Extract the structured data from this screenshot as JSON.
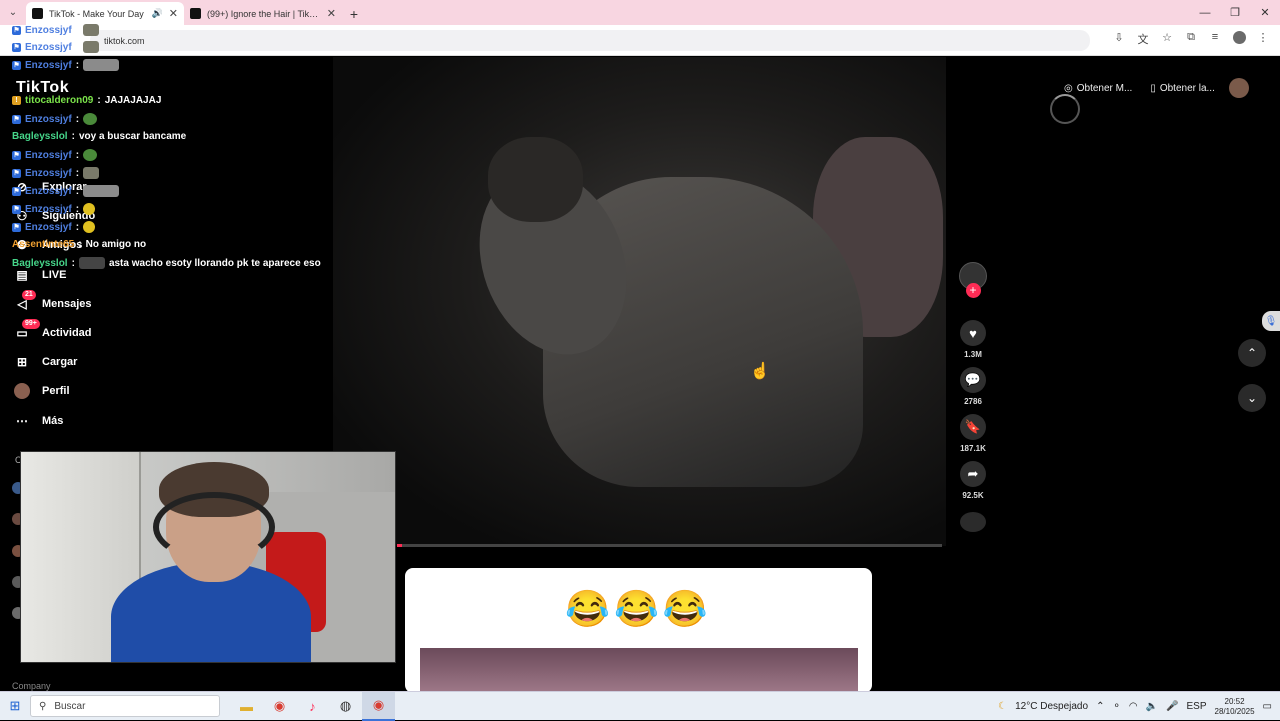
{
  "browser": {
    "tabs": [
      {
        "title": "TikTok - Make Your Day",
        "active": true,
        "audio": true
      },
      {
        "title": "(99+) Ignore the Hair | TikTok",
        "active": false
      }
    ],
    "url": "tiktok.com"
  },
  "sidebar": {
    "logo": "TikTok",
    "items": [
      {
        "label": "Explorar",
        "icon": "compass-icon"
      },
      {
        "label": "Siguiendo",
        "icon": "following-icon"
      },
      {
        "label": "Amigos",
        "icon": "friends-icon"
      },
      {
        "label": "LIVE",
        "icon": "live-icon"
      },
      {
        "label": "Mensajes",
        "icon": "messages-icon",
        "badge": "21"
      },
      {
        "label": "Actividad",
        "icon": "activity-icon",
        "badge": "99+"
      },
      {
        "label": "Cargar",
        "icon": "upload-icon"
      },
      {
        "label": "Perfil",
        "icon": "profile-avatar"
      },
      {
        "label": "Más",
        "icon": "more-icon"
      }
    ],
    "footer": "Company"
  },
  "chat": [
    {
      "user": "Enzossjyf",
      "msg": ""
    },
    {
      "user": "Enzossjyf",
      "msg": ""
    },
    {
      "user": "Enzossjyf",
      "msg": ""
    },
    {
      "user": "titocalderon09",
      "msg": "JAJAJAJAJ"
    },
    {
      "user": "Enzossjyf",
      "msg": ""
    },
    {
      "user": "Bagleysslol",
      "msg": "voy a buscar bancame"
    },
    {
      "user": "Enzossjyf",
      "msg": ""
    },
    {
      "user": "Enzossjyf",
      "msg": ""
    },
    {
      "user": "Enzossjyf",
      "msg": ""
    },
    {
      "user": "Enzossjyf",
      "msg": ""
    },
    {
      "user": "Enzossjyf",
      "msg": ""
    },
    {
      "user": "Assentinte65",
      "msg": "No amigo no"
    },
    {
      "user": "Bagleysslol",
      "msg": "asta wacho esoty llorando pk te aparece eso"
    }
  ],
  "video": {
    "progress": 0.01,
    "likes": "1.3M",
    "comments": "2786",
    "saves": "187.1K",
    "shares": "92.5K"
  },
  "topright": {
    "get_app_1": "Obtener M...",
    "get_app_2": "Obtener la..."
  },
  "card": {
    "emoji": "😂😂😂"
  },
  "taskbar": {
    "search_placeholder": "Buscar",
    "weather": "12°C  Despejado",
    "lang": "ESP",
    "time": "20:52",
    "date": "28/10/2025"
  },
  "colors": {
    "tiktok_red": "#fe2c55",
    "tab_bar": "#f8d6e1"
  }
}
